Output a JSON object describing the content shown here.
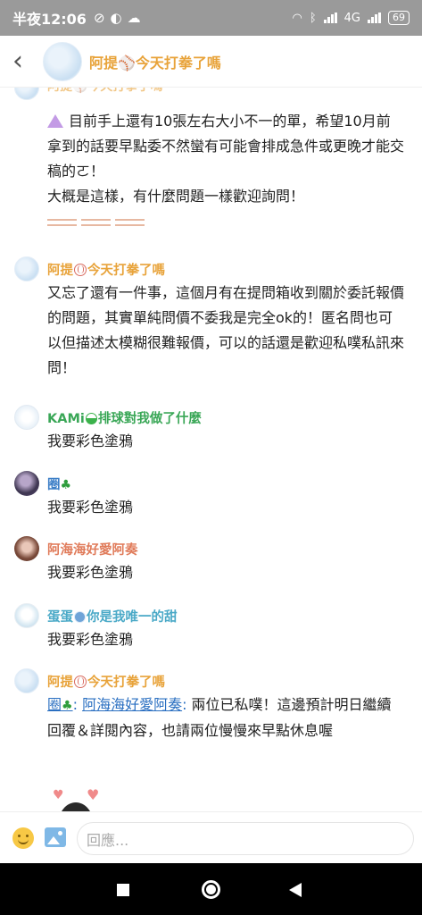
{
  "status_bar": {
    "time": "半夜12:06",
    "network": "4G",
    "battery": "69"
  },
  "header": {
    "back_icon": "chevron-left-icon",
    "title": "阿提⚾今天打拳了嗎"
  },
  "colors": {
    "atei_name": "#e8a33a",
    "kami_name": "#3aa757",
    "quan_name": "#3d7fc7",
    "ahai_name": "#e07b5a",
    "dandan_name": "#4aa9c7",
    "mention": "#2a6fc1"
  },
  "messages": [
    {
      "clipped_name": "阿提⚾今天打拳了嗎",
      "lines": [
        "目前手上還有10張左右大小不一的單，希望10月前拿到的話要早點委不然蠻有可能會排成急件或更晚才能交稿的ㄛ！",
        "大概是這樣，有什麼問題一樣歡迎詢問！"
      ]
    },
    {
      "name_prefix": "阿提",
      "name_suffix": "今天打拳了嗎",
      "text": "又忘了還有一件事，這個月有在提問箱收到關於委託報價的問題，其實單純問價不委我是完全ok的！匿名問也可以但描述太模糊很難報價，可以的話還是歡迎私噗私訊來問！"
    },
    {
      "name_prefix": "KAMi",
      "name_suffix": "排球對我做了什麼",
      "text": "我要彩色塗鴉"
    },
    {
      "name_prefix": "圈",
      "text": "我要彩色塗鴉"
    },
    {
      "name_prefix": "阿海海好愛阿奏",
      "text": "我要彩色塗鴉"
    },
    {
      "name_prefix": "蛋蛋",
      "name_suffix": "你是我唯一的甜",
      "text": "我要彩色塗鴉"
    },
    {
      "name_prefix": "阿提",
      "name_suffix": "今天打拳了嗎",
      "mention1": "圈",
      "mention2": "阿海海好愛阿奏",
      "colon": ":",
      "text_a": " 兩位已私噗！這邊預計明日繼續回覆＆詳閱內容，也請兩位慢慢來早點休息喔"
    }
  ],
  "composer": {
    "placeholder": "回應..."
  }
}
